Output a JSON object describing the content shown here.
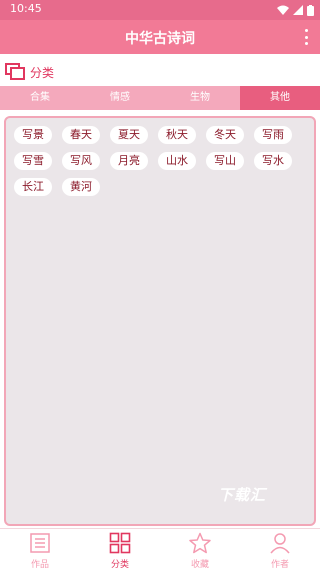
{
  "status": {
    "time": "10:45"
  },
  "app": {
    "title": "中华古诗词"
  },
  "section": {
    "title": "分类"
  },
  "tabs": [
    {
      "label": "合集",
      "active": false
    },
    {
      "label": "情感",
      "active": false
    },
    {
      "label": "生物",
      "active": false
    },
    {
      "label": "其他",
      "active": true
    }
  ],
  "categories": [
    "写景",
    "春天",
    "夏天",
    "秋天",
    "冬天",
    "写雨",
    "写雪",
    "写风",
    "月亮",
    "山水",
    "写山",
    "写水",
    "长江",
    "黄河"
  ],
  "watermark": "下载汇",
  "bottom_nav": [
    {
      "label": "作品",
      "icon": "document-icon",
      "active": false
    },
    {
      "label": "分类",
      "icon": "grid-icon",
      "active": true
    },
    {
      "label": "收藏",
      "icon": "star-icon",
      "active": false
    },
    {
      "label": "作者",
      "icon": "person-icon",
      "active": false
    }
  ],
  "colors": {
    "primary": "#f27a96",
    "status_bar": "#e76b8c",
    "accent": "#e1375f",
    "tab_active": "#e85e7f",
    "tab_bg": "#f4a9bc"
  }
}
